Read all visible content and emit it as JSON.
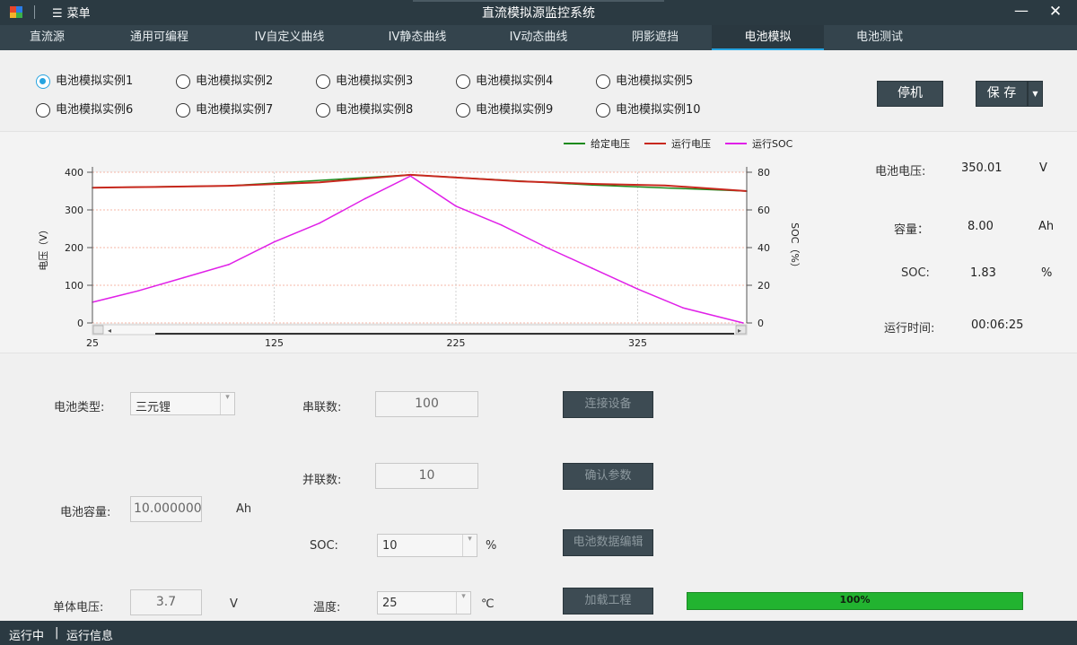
{
  "window": {
    "title": "直流模拟源监控系统",
    "menu_label": "菜单",
    "minimize_glyph": "—",
    "close_glyph": "✕"
  },
  "tabs": [
    {
      "label": "直流源"
    },
    {
      "label": "通用可编程"
    },
    {
      "label": "IV自定义曲线"
    },
    {
      "label": "IV静态曲线"
    },
    {
      "label": "IV动态曲线"
    },
    {
      "label": "阴影遮挡"
    },
    {
      "label": "电池模拟",
      "active": true
    },
    {
      "label": "电池测试"
    }
  ],
  "instances": [
    {
      "label": "电池模拟实例1",
      "checked": true
    },
    {
      "label": "电池模拟实例2"
    },
    {
      "label": "电池模拟实例3"
    },
    {
      "label": "电池模拟实例4"
    },
    {
      "label": "电池模拟实例5"
    },
    {
      "label": "电池模拟实例6"
    },
    {
      "label": "电池模拟实例7"
    },
    {
      "label": "电池模拟实例8"
    },
    {
      "label": "电池模拟实例9"
    },
    {
      "label": "电池模拟实例10"
    }
  ],
  "actions": {
    "stop_label": "停机",
    "save_label": "保 存"
  },
  "readouts": {
    "voltage_label": "电池电压:",
    "voltage_value": "350.01",
    "voltage_unit": "V",
    "capacity_label": "容量：",
    "capacity_value": "8.00",
    "capacity_unit": "Ah",
    "soc_label": "SOC:",
    "soc_value": "1.83",
    "soc_unit": "%",
    "runtime_label": "运行时间:",
    "runtime_value": "00:06:25"
  },
  "form": {
    "battery_type_label": "电池类型:",
    "battery_type_value": "三元锂",
    "series_label": "串联数:",
    "series_value": "100",
    "parallel_label": "并联数:",
    "parallel_value": "10",
    "capacity_label": "电池容量:",
    "capacity_value": "10.000000",
    "capacity_unit": "Ah",
    "soc_label": "SOC:",
    "soc_value": "10",
    "soc_unit": "%",
    "cell_voltage_label": "单体电压:",
    "cell_voltage_value": "3.7",
    "cell_voltage_unit": "V",
    "temp_label": "温度:",
    "temp_value": "25",
    "temp_unit": "℃",
    "connect_label": "连接设备",
    "confirm_label": "确认参数",
    "edit_label": "电池数据编辑",
    "load_label": "加载工程",
    "progress_value": 1.0,
    "progress_text": "100%"
  },
  "status": {
    "state": "运行中",
    "separator": "|",
    "info": "运行信息"
  },
  "colors": {
    "given_voltage": "#1a8a1a",
    "run_voltage": "#c8281e",
    "run_soc": "#e020e8",
    "accent": "#27a4e0",
    "progress": "#22b330"
  },
  "chart_data": {
    "type": "line",
    "legend": [
      "给定电压",
      "运行电压",
      "运行SOC"
    ],
    "legend_position": "top-right",
    "xlim": [
      25,
      385
    ],
    "x_ticks": [
      "25",
      "125",
      "225",
      "325"
    ],
    "y_left_label": "电压（V）",
    "y_left_lim": [
      0,
      400
    ],
    "y_left_ticks": [
      "0",
      "100",
      "200",
      "300",
      "400"
    ],
    "y_right_label": "SOC（%）",
    "y_right_lim": [
      0,
      80
    ],
    "y_right_ticks": [
      "0",
      "20",
      "40",
      "60",
      "80"
    ],
    "series": [
      {
        "name": "给定电压",
        "axis": "left",
        "x": [
          25,
          100,
          200,
          300,
          385
        ],
        "y": [
          359,
          364,
          393,
          366,
          350
        ]
      },
      {
        "name": "运行电压",
        "axis": "left",
        "x": [
          25,
          60,
          100,
          150,
          200,
          225,
          260,
          300,
          340,
          385
        ],
        "y": [
          359,
          361,
          364,
          373,
          393,
          386,
          376,
          369,
          365,
          350
        ]
      },
      {
        "name": "运行SOC",
        "axis": "right",
        "x": [
          25,
          50,
          75,
          100,
          125,
          150,
          175,
          200,
          225,
          250,
          275,
          300,
          325,
          350,
          383
        ],
        "y": [
          11,
          17,
          24,
          31,
          43,
          53,
          66,
          78,
          62,
          52,
          40,
          29,
          18,
          8,
          0
        ]
      }
    ]
  }
}
